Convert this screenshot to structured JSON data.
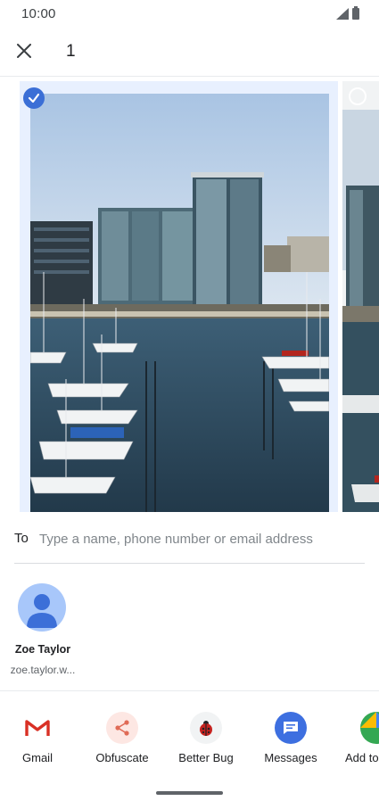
{
  "status_bar": {
    "time": "10:00"
  },
  "header": {
    "selected_count": "1"
  },
  "photos": [
    {
      "selected": true
    },
    {
      "selected": false
    }
  ],
  "recipient": {
    "label": "To",
    "placeholder": "Type a name, phone number or email address"
  },
  "contacts": [
    {
      "name": "Zoe Taylor",
      "email": "zoe.taylor.w..."
    }
  ],
  "apps": [
    {
      "label": "Gmail",
      "icon": "gmail-icon"
    },
    {
      "label": "Obfuscate",
      "icon": "share-icon"
    },
    {
      "label": "Better Bug",
      "icon": "ladybug-icon"
    },
    {
      "label": "Messages",
      "icon": "messages-icon"
    },
    {
      "label": "Add to",
      "icon": "maps-icon"
    }
  ],
  "colors": {
    "accent": "#3b6fd6",
    "messages": "#3d6fe0"
  }
}
